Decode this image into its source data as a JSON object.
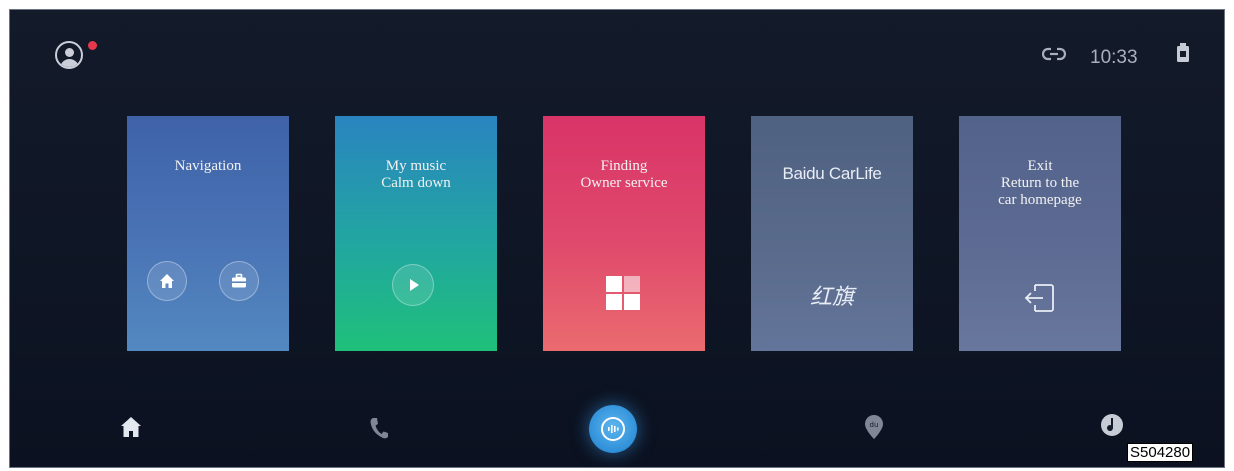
{
  "status_bar": {
    "time": "10:33"
  },
  "cards": {
    "navigation": {
      "title": "Navigation"
    },
    "music": {
      "line1": "My music",
      "line2": "Calm down"
    },
    "finding": {
      "line1": "Finding",
      "line2": "Owner service"
    },
    "carlife": {
      "logo": "Baidu CarLife",
      "brand_mark": "红旗"
    },
    "exit": {
      "line1": "Exit",
      "line2": "Return to the",
      "line3": "car homepage"
    }
  },
  "dock": {
    "items": [
      "home-icon",
      "phone-icon",
      "voice-assistant-icon",
      "map-pin-icon",
      "music-note-icon"
    ]
  },
  "figure_code": "S504280",
  "colors": {
    "background": "#0e1524",
    "accent_blue": "#2f8fd8",
    "notification_red": "#e5394b"
  }
}
